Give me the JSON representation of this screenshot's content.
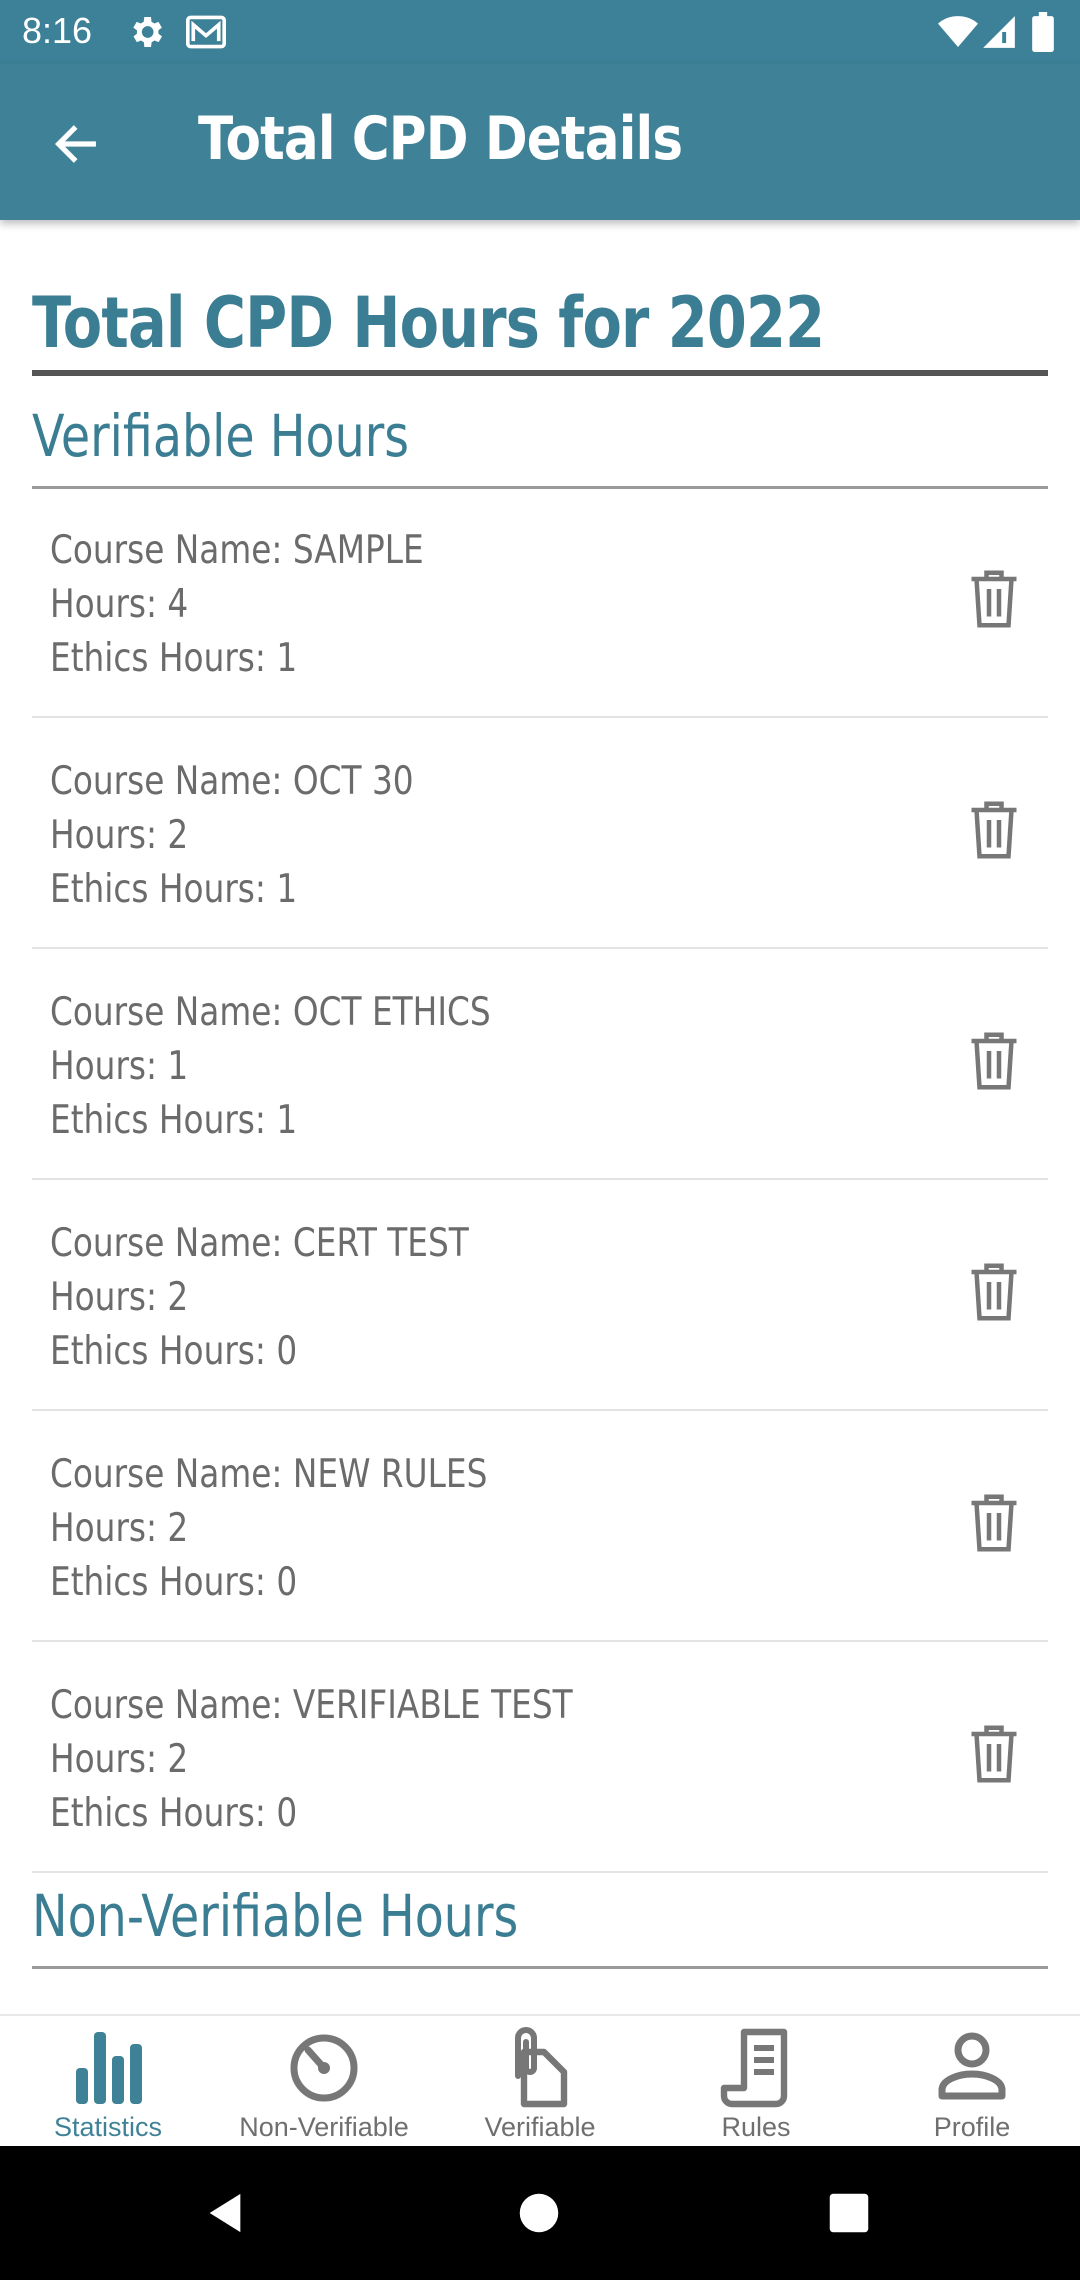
{
  "status_bar": {
    "time": "8:16"
  },
  "app_bar": {
    "title": "Total CPD Details"
  },
  "page": {
    "heading": "Total CPD Hours for 2022",
    "sections": {
      "verifiable_title": "Verifiable Hours",
      "non_verifiable_title": "Non-Verifiable Hours"
    },
    "records": [
      {
        "course": "Course Name: SAMPLE",
        "hours": "Hours: 4",
        "ethics": "Ethics Hours: 1"
      },
      {
        "course": "Course Name: OCT 30",
        "hours": "Hours: 2",
        "ethics": "Ethics Hours: 1"
      },
      {
        "course": "Course Name: OCT ETHICS",
        "hours": "Hours: 1",
        "ethics": "Ethics Hours: 1"
      },
      {
        "course": "Course Name: CERT TEST",
        "hours": "Hours: 2",
        "ethics": "Ethics Hours: 0"
      },
      {
        "course": "Course Name: NEW RULES",
        "hours": "Hours: 2",
        "ethics": "Ethics Hours: 0"
      },
      {
        "course": "Course Name: VERIFIABLE TEST",
        "hours": "Hours: 2",
        "ethics": "Ethics Hours: 0"
      }
    ]
  },
  "bottom_nav": {
    "items": [
      {
        "label": "Statistics",
        "icon": "bar-chart-icon",
        "active": true
      },
      {
        "label": "Non-Verifiable",
        "icon": "timer-icon",
        "active": false
      },
      {
        "label": "Verifiable",
        "icon": "attachment-icon",
        "active": false
      },
      {
        "label": "Rules",
        "icon": "document-icon",
        "active": false
      },
      {
        "label": "Profile",
        "icon": "person-icon",
        "active": false
      }
    ]
  },
  "colors": {
    "primary": "#3f8297",
    "heading_text": "#3b7d92",
    "body_text": "#6b6b6b",
    "nav_inactive": "#6f6f6f"
  }
}
